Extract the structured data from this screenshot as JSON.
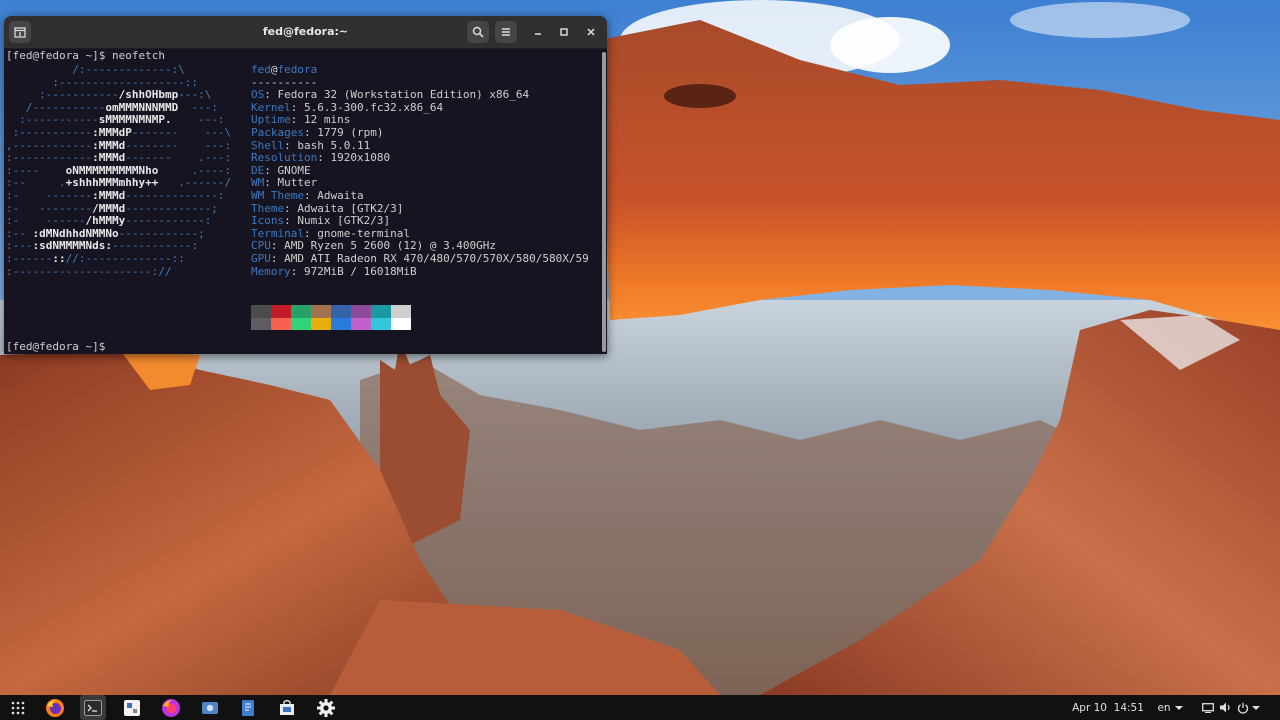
{
  "terminal": {
    "title": "fed@fedora:~",
    "prompt_line_1": "[fed@fedora ~]$ neofetch",
    "prompt_line_2": "[fed@fedora ~]$",
    "user": "fed",
    "at": "@",
    "host": "fedora",
    "separator": "----------",
    "info": [
      {
        "key": "OS",
        "value": "Fedora 32 (Workstation Edition) x86_64"
      },
      {
        "key": "Kernel",
        "value": "5.6.3-300.fc32.x86_64"
      },
      {
        "key": "Uptime",
        "value": "12 mins"
      },
      {
        "key": "Packages",
        "value": "1779 (rpm)"
      },
      {
        "key": "Shell",
        "value": "bash 5.0.11"
      },
      {
        "key": "Resolution",
        "value": "1920x1080"
      },
      {
        "key": "DE",
        "value": "GNOME"
      },
      {
        "key": "WM",
        "value": "Mutter"
      },
      {
        "key": "WM Theme",
        "value": "Adwaita"
      },
      {
        "key": "Theme",
        "value": "Adwaita [GTK2/3]"
      },
      {
        "key": "Icons",
        "value": "Numix [GTK2/3]"
      },
      {
        "key": "Terminal",
        "value": "gnome-terminal"
      },
      {
        "key": "CPU",
        "value": "AMD Ryzen 5 2600 (12) @ 3.400GHz"
      },
      {
        "key": "GPU",
        "value": "AMD ATI Radeon RX 470/480/570/570X/580/580X/59"
      },
      {
        "key": "Memory",
        "value": "972MiB / 16018MiB"
      }
    ],
    "logo_lines": [
      "          /:-------------:\\",
      "       :-------------------::",
      "     :-----------/shhOHbmp---:\\",
      "   /-----------omMMMNNNMMD  ---:",
      "  :-----------sMMMMNMNMP.    ---:",
      " :-----------:MMMdP-------    ---\\",
      ",------------:MMMd--------    ---:",
      ":------------:MMMd-------    .---:",
      ":----    oNMMMMMMMMMNho     .----:",
      ":--     .+shhhMMMmhhy++   .------/",
      ":-    -------:MMMd--------------:",
      ":-   --------/MMMd-------------;",
      ":-    ------/hMMMy------------:",
      ":-- :dMNdhhdNMMNo------------;",
      ":---:sdNMMMMNds:------------:",
      ":------:://:-------------::",
      ":---------------------://"
    ],
    "logo_highlights": [
      "",
      "",
      "/shhOHbmp",
      "omMMMNNNMMD",
      "sMMMMNMNMP.",
      ":MMMdP",
      ":MMMd",
      ":MMMd",
      "oNMMMMMMMMMNho",
      "+shhhMMMmhhy++",
      ":MMMd",
      "/MMMd",
      "/hMMMy",
      ":dMNdhhdNMMNo",
      ":sdNMMMMNds:",
      "::",
      ""
    ],
    "palette_top": [
      "#4b4b4b",
      "#c01c28",
      "#26a269",
      "#a2734c",
      "#3463a8",
      "#8e4a9a",
      "#1a9aa0",
      "#cfcfcf"
    ],
    "palette_bottom": [
      "#5e5c64",
      "#f66151",
      "#33d17a",
      "#e9ad0c",
      "#2a7bde",
      "#c061cb",
      "#33c7de",
      "#ffffff"
    ]
  },
  "taskbar": {
    "apps": [
      {
        "name": "apps-grid-icon"
      },
      {
        "name": "firefox-icon"
      },
      {
        "name": "terminal-icon"
      },
      {
        "name": "software-icon"
      },
      {
        "name": "firefox-dev-icon"
      },
      {
        "name": "screenshot-icon"
      },
      {
        "name": "text-editor-icon"
      },
      {
        "name": "store-icon"
      },
      {
        "name": "settings-gear-icon"
      }
    ],
    "clock": "Apr 10  14:51",
    "keyboard_layout": "en"
  }
}
